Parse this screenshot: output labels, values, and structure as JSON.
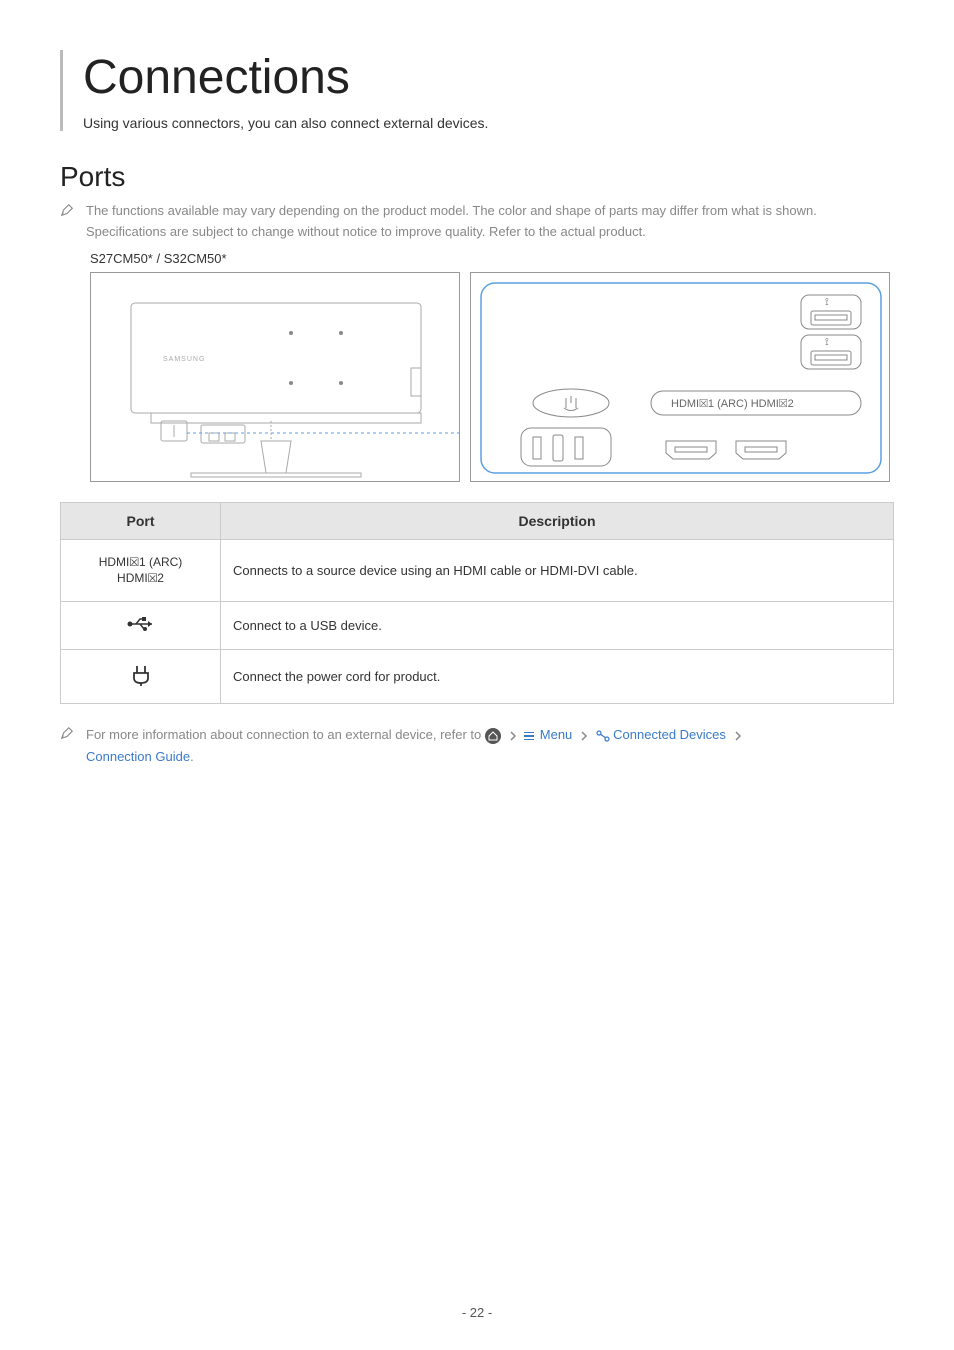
{
  "title": "Connections",
  "subtitle": "Using various connectors, you can also connect external devices.",
  "section_heading": "Ports",
  "note1": "The functions available may vary depending on the product model. The color and shape of parts may differ from what is shown. Specifications are subject to change without notice to improve quality. Refer to the actual product.",
  "model": "S27CM50* / S32CM50*",
  "diagram_port_label_1": "HDMI⮽1 (ARC)",
  "diagram_port_label_2": "HDMI⮽2",
  "diagram_brand": "SAMSUNG",
  "table": {
    "headers": [
      "Port",
      "Description"
    ],
    "rows": [
      {
        "port_line1": "HDMI⮽1 (ARC)",
        "port_line2": "HDMI⮽2",
        "desc": "Connects to a source device using an HDMI cable or HDMI-DVI cable."
      },
      {
        "port_line1": "usb-icon",
        "desc": "Connect to a USB device."
      },
      {
        "port_line1": "power-icon",
        "desc": "Connect the power cord for product."
      }
    ]
  },
  "footer_prefix": "For more information about connection to an external device, refer to ",
  "footer_menu": "Menu",
  "footer_connected": "Connected Devices",
  "footer_guide": "Connection Guide",
  "footer_period": ".",
  "page_number": "- 22 -"
}
